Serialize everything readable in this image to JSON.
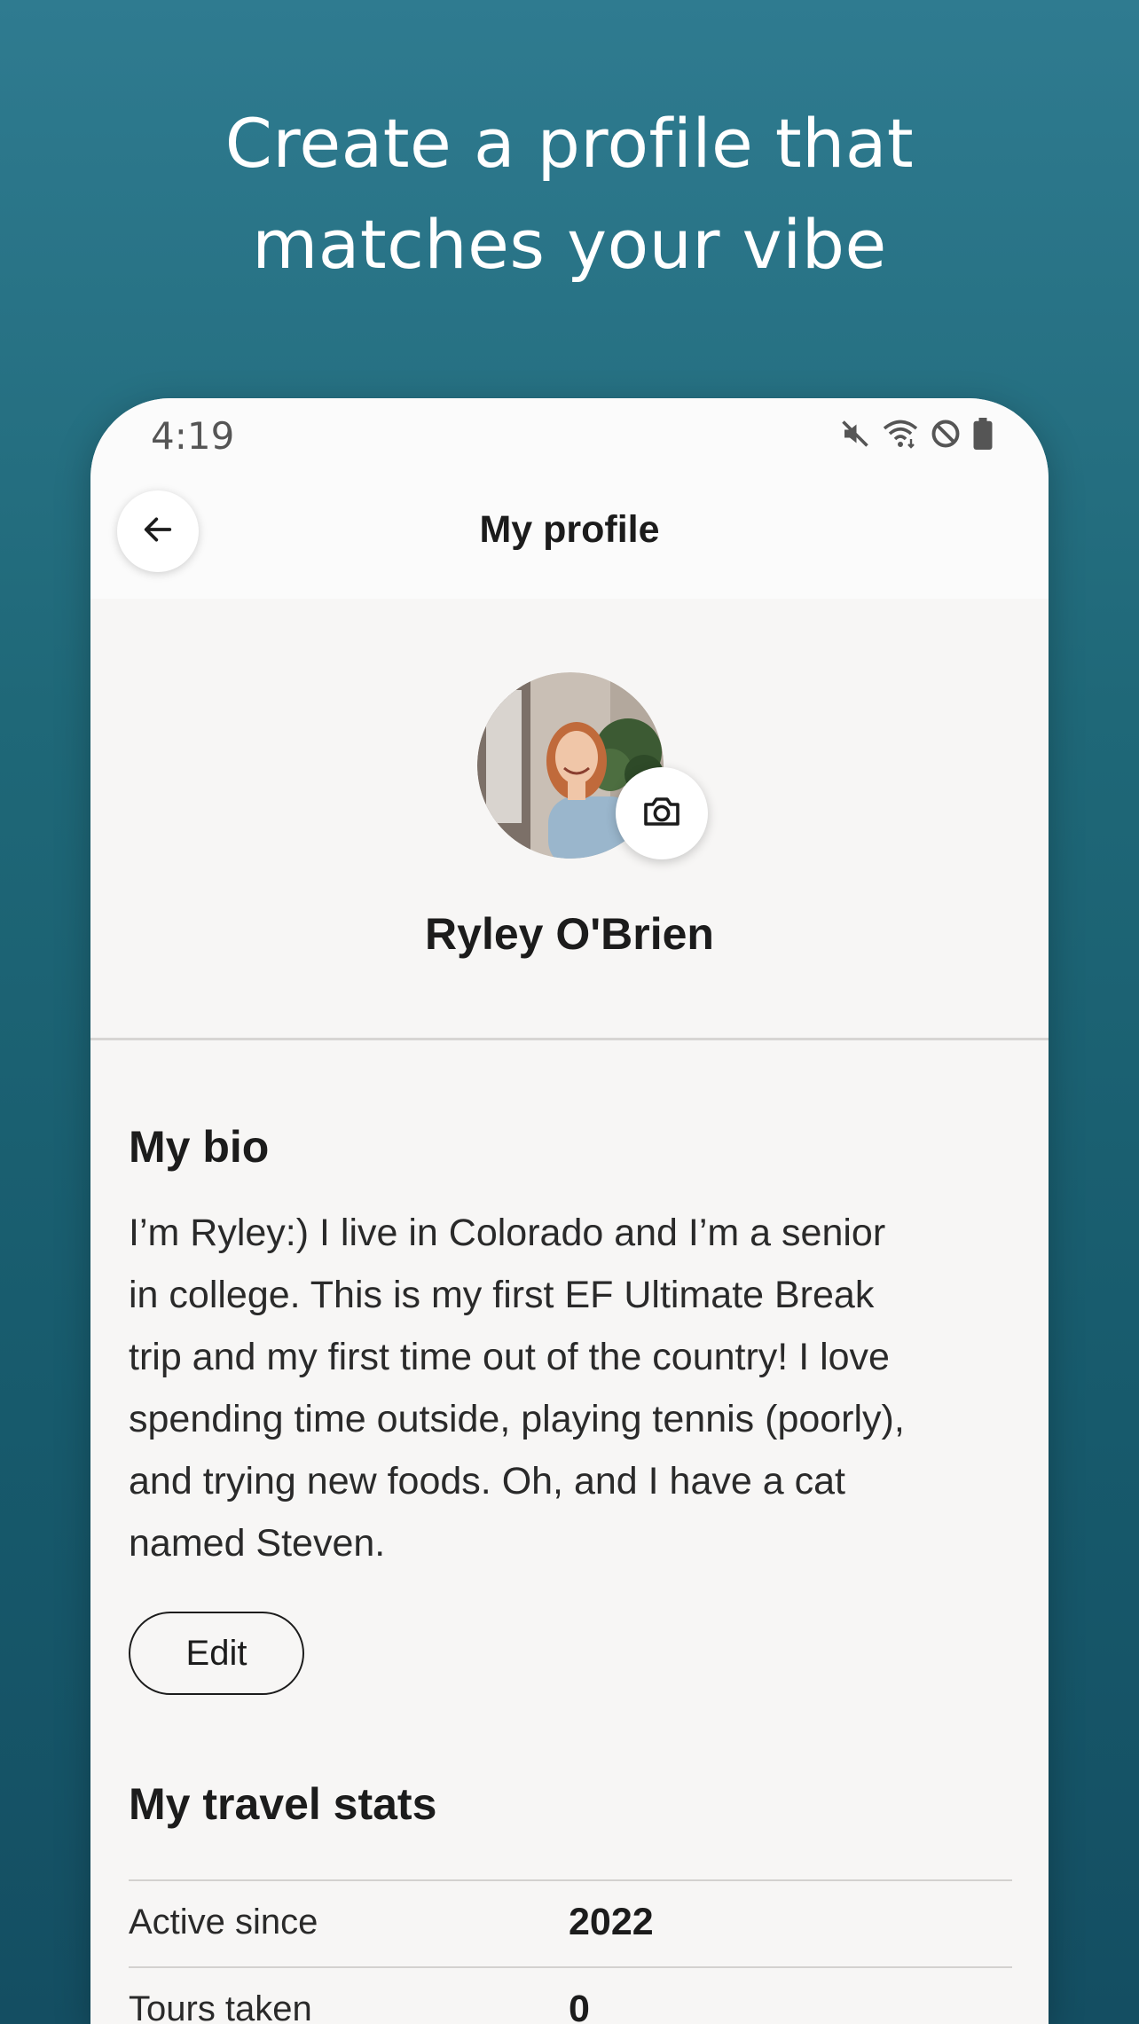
{
  "headline": {
    "line1": "Create a profile that",
    "line2": "matches your vibe"
  },
  "status_bar": {
    "time": "4:19",
    "icons": [
      "mute-icon",
      "wifi-icon",
      "do-not-disturb-icon",
      "battery-icon"
    ]
  },
  "app_bar": {
    "back_icon": "arrow-left-icon",
    "title": "My profile"
  },
  "profile": {
    "name": "Ryley O'Brien",
    "camera_icon": "camera-icon"
  },
  "bio": {
    "title": "My bio",
    "lines": [
      "I’m Ryley:) I live in Colorado and I’m a senior",
      "in college. This is my first EF Ultimate Break",
      "trip and my first time out of the country! I love",
      "spending time outside, playing tennis (poorly),",
      "and trying new foods. Oh, and I have a cat",
      "named Steven."
    ],
    "edit_label": "Edit"
  },
  "travel_stats": {
    "title": "My travel stats",
    "rows": [
      {
        "label": "Active since",
        "value": "2022"
      },
      {
        "label": "Tours taken",
        "value": "0"
      }
    ]
  },
  "colors": {
    "background_top": "#2f7b90",
    "background_bottom": "#144e62",
    "phone_surface": "#f7f6f5",
    "text_primary": "#1c1c1c"
  }
}
